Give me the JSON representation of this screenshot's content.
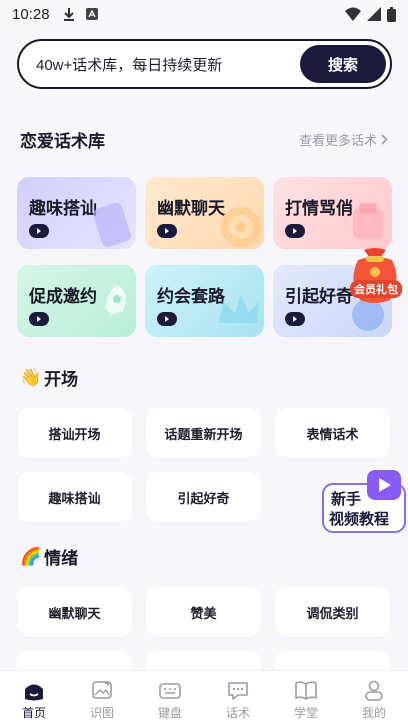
{
  "status_bar": {
    "time": "10:28"
  },
  "search": {
    "placeholder": "40w+话术库，每日持续更新",
    "button_label": "搜索"
  },
  "library": {
    "title": "恋爱话术库",
    "more_label": "查看更多话术",
    "cards": [
      {
        "label": "趣味搭讪",
        "bg": "#d9d6fb"
      },
      {
        "label": "幽默聊天",
        "bg": "#ffe3c4"
      },
      {
        "label": "打情骂俏",
        "bg": "#ffd9dc"
      },
      {
        "label": "促成邀约",
        "bg": "#cff3e1"
      },
      {
        "label": "约会套路",
        "bg": "#c6eef7"
      },
      {
        "label": "引起好奇",
        "bg": "#dbe4fb"
      }
    ]
  },
  "gift_badge": {
    "label": "会员礼包"
  },
  "groups": [
    {
      "emoji": "👋",
      "title": "开场",
      "items": [
        "搭讪开场",
        "话题重新开场",
        "表情话术",
        "趣味搭讪",
        "引起好奇"
      ]
    },
    {
      "emoji": "🌈",
      "title": "情绪",
      "items": [
        "幽默聊天",
        "赞美",
        "调侃类别"
      ]
    }
  ],
  "tutorial_badge": {
    "line1": "新手",
    "line2": "视频教程"
  },
  "tabs": [
    {
      "label": "首页",
      "icon": "home-icon",
      "active": true
    },
    {
      "label": "识图",
      "icon": "image-icon",
      "active": false
    },
    {
      "label": "键盘",
      "icon": "keyboard-icon",
      "active": false
    },
    {
      "label": "话术",
      "icon": "chat-icon",
      "active": false
    },
    {
      "label": "学堂",
      "icon": "book-icon",
      "active": false
    },
    {
      "label": "我的",
      "icon": "profile-icon",
      "active": false
    }
  ]
}
